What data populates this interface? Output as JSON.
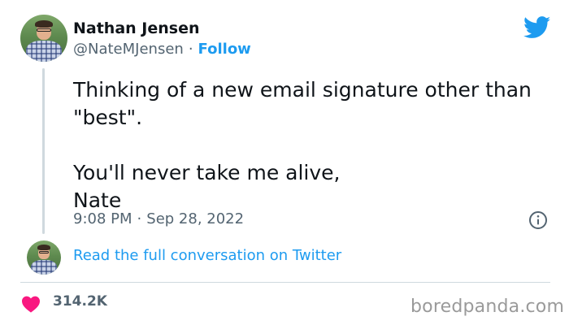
{
  "author": {
    "name": "Nathan Jensen",
    "handle": "@NateMJensen",
    "separator": "·",
    "follow_label": "Follow",
    "avatar_icon": "profile-photo"
  },
  "tweet": {
    "lines": [
      "Thinking of a new email signature other than",
      "\"best\".",
      "You'll never take me alive,",
      "Nate"
    ],
    "time": "9:08 PM",
    "separator": "·",
    "date": "Sep 28, 2022"
  },
  "conversation": {
    "link_label": "Read the full conversation on Twitter"
  },
  "engagement": {
    "likes": "314.2K",
    "heart_color": "#f91880"
  },
  "watermark": "boredpanda.com",
  "colors": {
    "twitter_blue": "#1d9bf0",
    "text": "#0f1419",
    "muted": "#536471",
    "divider": "#cfd9de"
  },
  "icons": [
    "twitter-bird-icon",
    "info-icon",
    "heart-icon"
  ]
}
